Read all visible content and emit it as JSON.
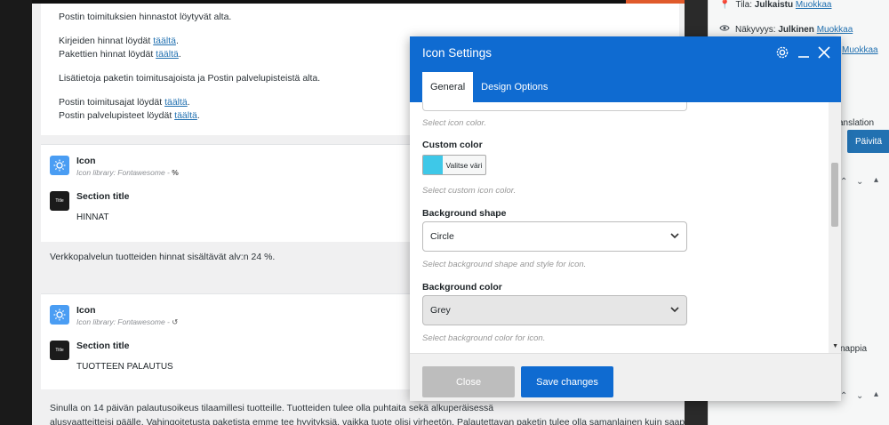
{
  "page": {
    "para1": "Postin toimituksien hinnastot löytyvät alta.",
    "letters_price_prefix": "Kirjeiden hinnat löydät ",
    "letters_price_link": "täältä",
    "parcels_price_prefix": "Pakettien hinnat löydät ",
    "parcels_price_link": "täältä",
    "para3": "Lisätietoja paketin toimitusajoista ja Postin palvelupisteistä alta.",
    "delivery_prefix": "Postin toimitusajat löydät ",
    "delivery_link": "täältä",
    "points_prefix": "Postin palvelupisteet löydät ",
    "points_link": "täältä",
    "module1_title": "Icon",
    "module1_sub": "Icon library: Fontawesome - ",
    "module2_title": "Section title",
    "module2_value": "HINNAT",
    "vat_text": "Verkkopalvelun tuotteiden hinnat sisältävät alv:n 24 %.",
    "module3_title": "Icon",
    "module3_sub": "Icon library: Fontawesome - ",
    "module4_title": "Section title",
    "module4_value": "TUOTTEEN PALAUTUS",
    "dark_icon_text": "Title",
    "return_line1": "Sinulla on 14 päivän palautusoikeus tilaamillesi tuotteille. Tuotteiden tulee olla puhtaita sekä al",
    "return_line1_hidden": "kuperäisessä",
    "return_line2": "alusvaatteitteisi päälle. Vahingoitetusta paketista emme tee hyvityksiä, vaikka tuote olisi virheetön. Palautettavan paketin tulee olla samanlainen kuin saapuessaan."
  },
  "sidebar": {
    "status_label": "Tila: ",
    "status_value": "Julkaistu",
    "status_link": "Muokkaa",
    "visibility_label": "Näkyvyys: ",
    "visibility_value": "Julkinen",
    "visibility_link": "Muokkaa",
    "third_link": "Muokkaa",
    "translation_label": "anslation",
    "update_button": "Päivitä",
    "nappia_text": "nappia"
  },
  "modal": {
    "title": "Icon Settings",
    "tab_general": "General",
    "tab_design": "Design Options",
    "hint_icon_color": "Select icon color.",
    "custom_color_label": "Custom color",
    "color_button_label": "Valitse väri",
    "custom_color_swatch": "#3ec8e8",
    "hint_custom_color": "Select custom icon color.",
    "bg_shape_label": "Background shape",
    "bg_shape_value": "Circle",
    "hint_bg_shape": "Select background shape and style for icon.",
    "bg_color_label": "Background color",
    "bg_color_value": "Grey",
    "hint_bg_color": "Select background color for icon.",
    "close_button": "Close",
    "save_button": "Save changes"
  },
  "colors": {
    "accent": "#0f6bd1",
    "link": "#2271b1"
  }
}
